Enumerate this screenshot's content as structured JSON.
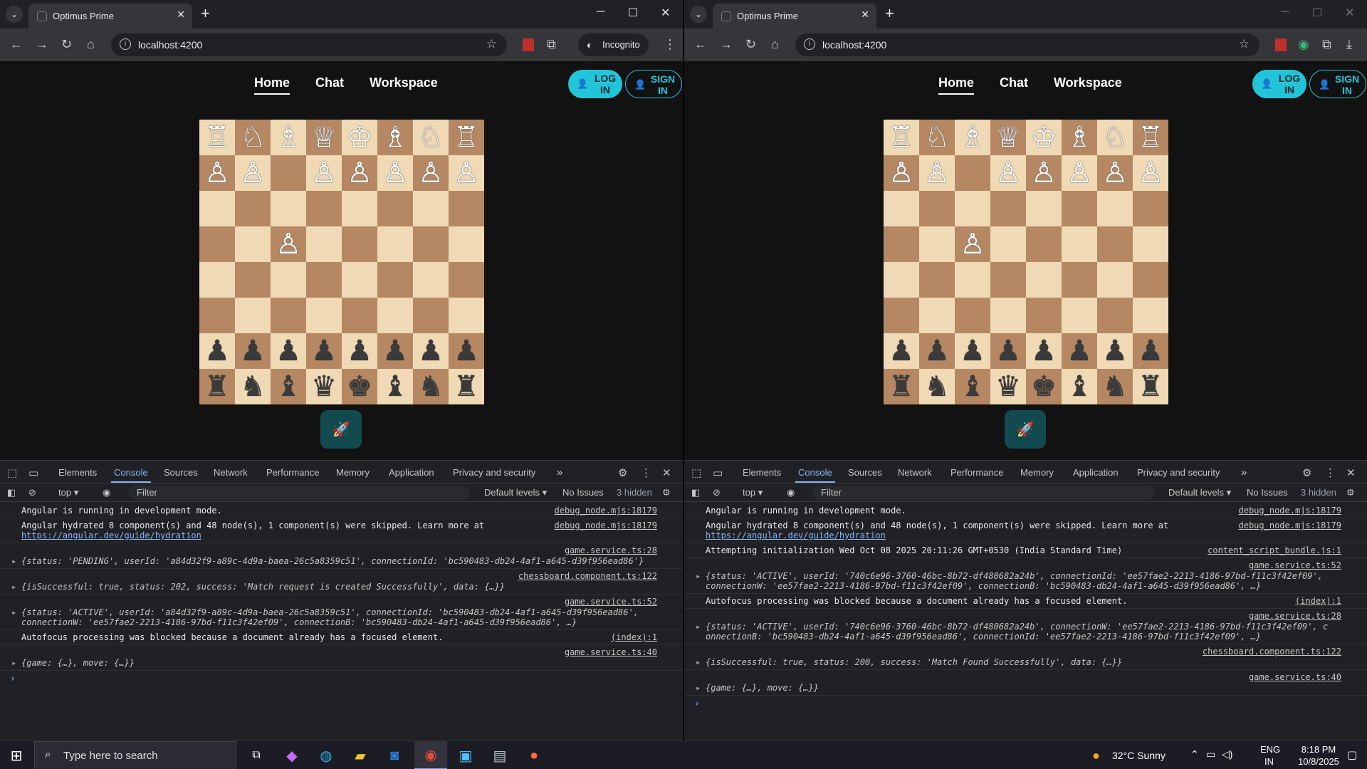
{
  "windows": [
    {
      "tab_title": "Optimus Prime",
      "url": "localhost:4200",
      "incognito_label": "Incognito",
      "nav": [
        "Home",
        "Chat",
        "Workspace"
      ],
      "login": "LOG IN",
      "signin": "SIGN IN",
      "logs": [
        {
          "text": "Angular is running in development mode.",
          "src": "debug_node.mjs:18179"
        },
        {
          "text": "Angular hydrated 8 component(s) and 48 node(s), 1 component(s) were skipped. Learn more at",
          "link": "https://angular.dev/guide/hydration",
          "src": "debug_node.mjs:18179"
        },
        {
          "obj": true,
          "text": "{status: 'PENDING', userId: 'a84d32f9-a89c-4d9a-baea-26c5a8359c51', connectionId: 'bc590483-db24-4af1-a645-d39f956ead86'}",
          "src": "game.service.ts:28"
        },
        {
          "obj": true,
          "text": "{isSuccessful: true, status: 202, success: 'Match request is created Successfully', data: {…}}",
          "src": "chessboard.component.ts:122"
        },
        {
          "obj": true,
          "text": "{status: 'ACTIVE', userId: 'a84d32f9-a89c-4d9a-baea-26c5a8359c51', connectionId: 'bc590483-db24-4af1-a645-d39f956ead86',\nconnectionW: 'ee57fae2-2213-4186-97bd-f11c3f42ef09', connectionB: 'bc590483-db24-4af1-a645-d39f956ead86', …}",
          "src": "game.service.ts:52"
        },
        {
          "text": "Autofocus processing was blocked because a document already has a focused element.",
          "src": "(index):1"
        },
        {
          "obj": true,
          "text": "{game: {…}, move: {…}}",
          "src": "game.service.ts:40"
        }
      ]
    },
    {
      "tab_title": "Optimus Prime",
      "url": "localhost:4200",
      "nav": [
        "Home",
        "Chat",
        "Workspace"
      ],
      "login": "LOG IN",
      "signin": "SIGN IN",
      "logs": [
        {
          "text": "Angular is running in development mode.",
          "src": "debug_node.mjs:18179"
        },
        {
          "text": "Angular hydrated 8 component(s) and 48 node(s), 1 component(s) were skipped. Learn more at",
          "link": "https://angular.dev/guide/hydration",
          "src": "debug_node.mjs:18179"
        },
        {
          "text": "Attempting initialization Wed Oct 08 2025 20:11:26 GMT+0530 (India Standard Time)",
          "src": "content_script_bundle.js:1"
        },
        {
          "obj": true,
          "text": "{status: 'ACTIVE', userId: '740c6e96-3760-46bc-8b72-df480682a24b', connectionId: 'ee57fae2-2213-4186-97bd-f11c3f42ef09',\nconnectionW: 'ee57fae2-2213-4186-97bd-f11c3f42ef09', connectionB: 'bc590483-db24-4af1-a645-d39f956ead86', …}",
          "src": "game.service.ts:52"
        },
        {
          "text": "Autofocus processing was blocked because a document already has a focused element.",
          "src": "(index):1"
        },
        {
          "obj": true,
          "text": "{status: 'ACTIVE', userId: '740c6e96-3760-46bc-8b72-df480682a24b', connectionW: 'ee57fae2-2213-4186-97bd-f11c3f42ef09', c\nonnectionB: 'bc590483-db24-4af1-a645-d39f956ead86', connectionId: 'ee57fae2-2213-4186-97bd-f11c3f42ef09', …}",
          "src": "game.service.ts:28"
        },
        {
          "obj": true,
          "text": "{isSuccessful: true, status: 200, success: 'Match Found Successfully', data: {…}}",
          "src": "chessboard.component.ts:122"
        },
        {
          "obj": true,
          "text": "{game: {…}, move: {…}}",
          "src": "game.service.ts:40"
        }
      ]
    }
  ],
  "board": [
    [
      "wr",
      "wn",
      "wb",
      "wq",
      "wk",
      "wb",
      "wn",
      "wr"
    ],
    [
      "wp",
      "wp",
      "",
      "wp",
      "wp",
      "wp",
      "wp",
      "wp"
    ],
    [
      "",
      "",
      "",
      "",
      "",
      "",
      "",
      ""
    ],
    [
      "",
      "",
      "wp",
      "",
      "",
      "",
      "",
      ""
    ],
    [
      "",
      "",
      "",
      "",
      "",
      "",
      "",
      ""
    ],
    [
      "",
      "",
      "",
      "",
      "",
      "",
      "",
      ""
    ],
    [
      "bp",
      "bp",
      "bp",
      "bp",
      "bp",
      "bp",
      "bp",
      "bp"
    ],
    [
      "br",
      "bn",
      "bb",
      "bq",
      "bk",
      "bb",
      "bn",
      "br"
    ]
  ],
  "devtools": {
    "tabs": [
      "Elements",
      "Console",
      "Sources",
      "Network",
      "Performance",
      "Memory",
      "Application",
      "Privacy and security"
    ],
    "context": "top",
    "filter_placeholder": "Filter",
    "levels": "Default levels",
    "issues": "No Issues",
    "hidden": "3 hidden"
  },
  "taskbar": {
    "search_placeholder": "Type here to search",
    "weather": "32°C  Sunny",
    "lang": "ENG",
    "region": "IN",
    "time": "8:18 PM",
    "date": "10/8/2025"
  },
  "colors": {
    "accent": "#22c4d8",
    "light_square": "#f0d9b5",
    "dark_square": "#b58863"
  }
}
